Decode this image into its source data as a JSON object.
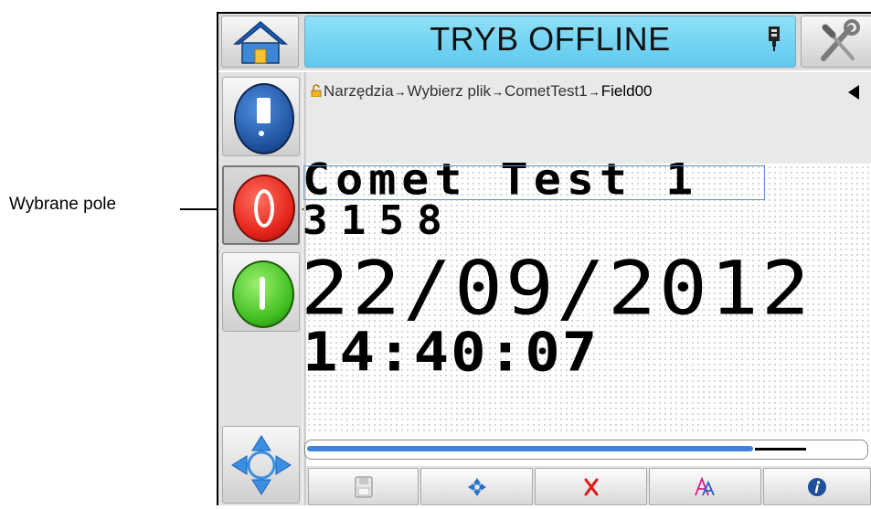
{
  "callout": {
    "label": "Wybrane pole"
  },
  "header": {
    "title": "TRYB OFFLINE"
  },
  "breadcrumb": {
    "items": [
      "Narzędzia",
      "Wybierz plik",
      "CometTest1",
      "Field00"
    ],
    "separator": "→"
  },
  "editor": {
    "lines": [
      "Comet Test 1",
      "3158",
      "22/09/2012",
      "14:40:07"
    ]
  },
  "progress": {
    "value_percent": 80
  },
  "icons": {
    "home": "home-icon",
    "ink": "ink-cartridge-icon",
    "tools": "tools-icon",
    "lock": "lock-icon",
    "back": "back-arrow-icon",
    "ink_bottle": "ink-bottle-icon",
    "stop": "stop-icon",
    "start": "start-icon",
    "navigate": "move-arrows-icon",
    "save": "save-icon",
    "move_field": "move-field-icon",
    "delete": "delete-icon",
    "font": "font-icon",
    "info": "info-icon"
  },
  "colors": {
    "title_bar": "#6dd3f3",
    "stop_button": "#e32219",
    "start_button": "#3fbe1f",
    "ink_button": "#1d4f9a",
    "selection_box": "#5b8fd6",
    "progress_fill": "#3d83d9",
    "delete_x": "#e01818",
    "info": "#1d4f9a"
  }
}
